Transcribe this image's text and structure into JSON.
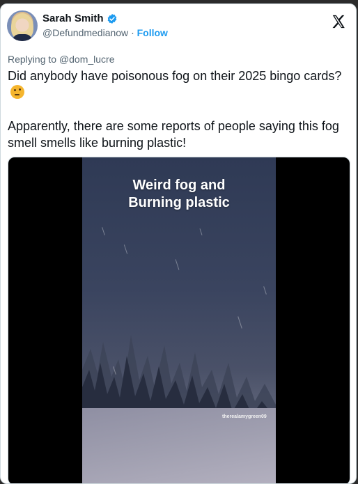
{
  "author": {
    "name": "Sarah Smith",
    "handle": "@Defundmedianow",
    "separator": "·",
    "follow_label": "Follow",
    "verified_color": "#1d9bf0"
  },
  "icons": {
    "brand": "x-logo-icon",
    "verified": "verified-badge-icon",
    "emoji": "thinking-face-emoji"
  },
  "tweet": {
    "replying_to": "Replying to @dom_lucre",
    "paragraph_1": "Did anybody have poisonous fog on their 2025 bingo cards?",
    "paragraph_2": "Apparently, there are some reports of people saying this fog smell smells like burning plastic!"
  },
  "media": {
    "overlay_line_1": "Weird fog and",
    "overlay_line_2": "Burning plastic",
    "watermark": "therealamygreen09"
  },
  "colors": {
    "text": "#0f1419",
    "secondary": "#536471",
    "accent": "#1d9bf0"
  }
}
